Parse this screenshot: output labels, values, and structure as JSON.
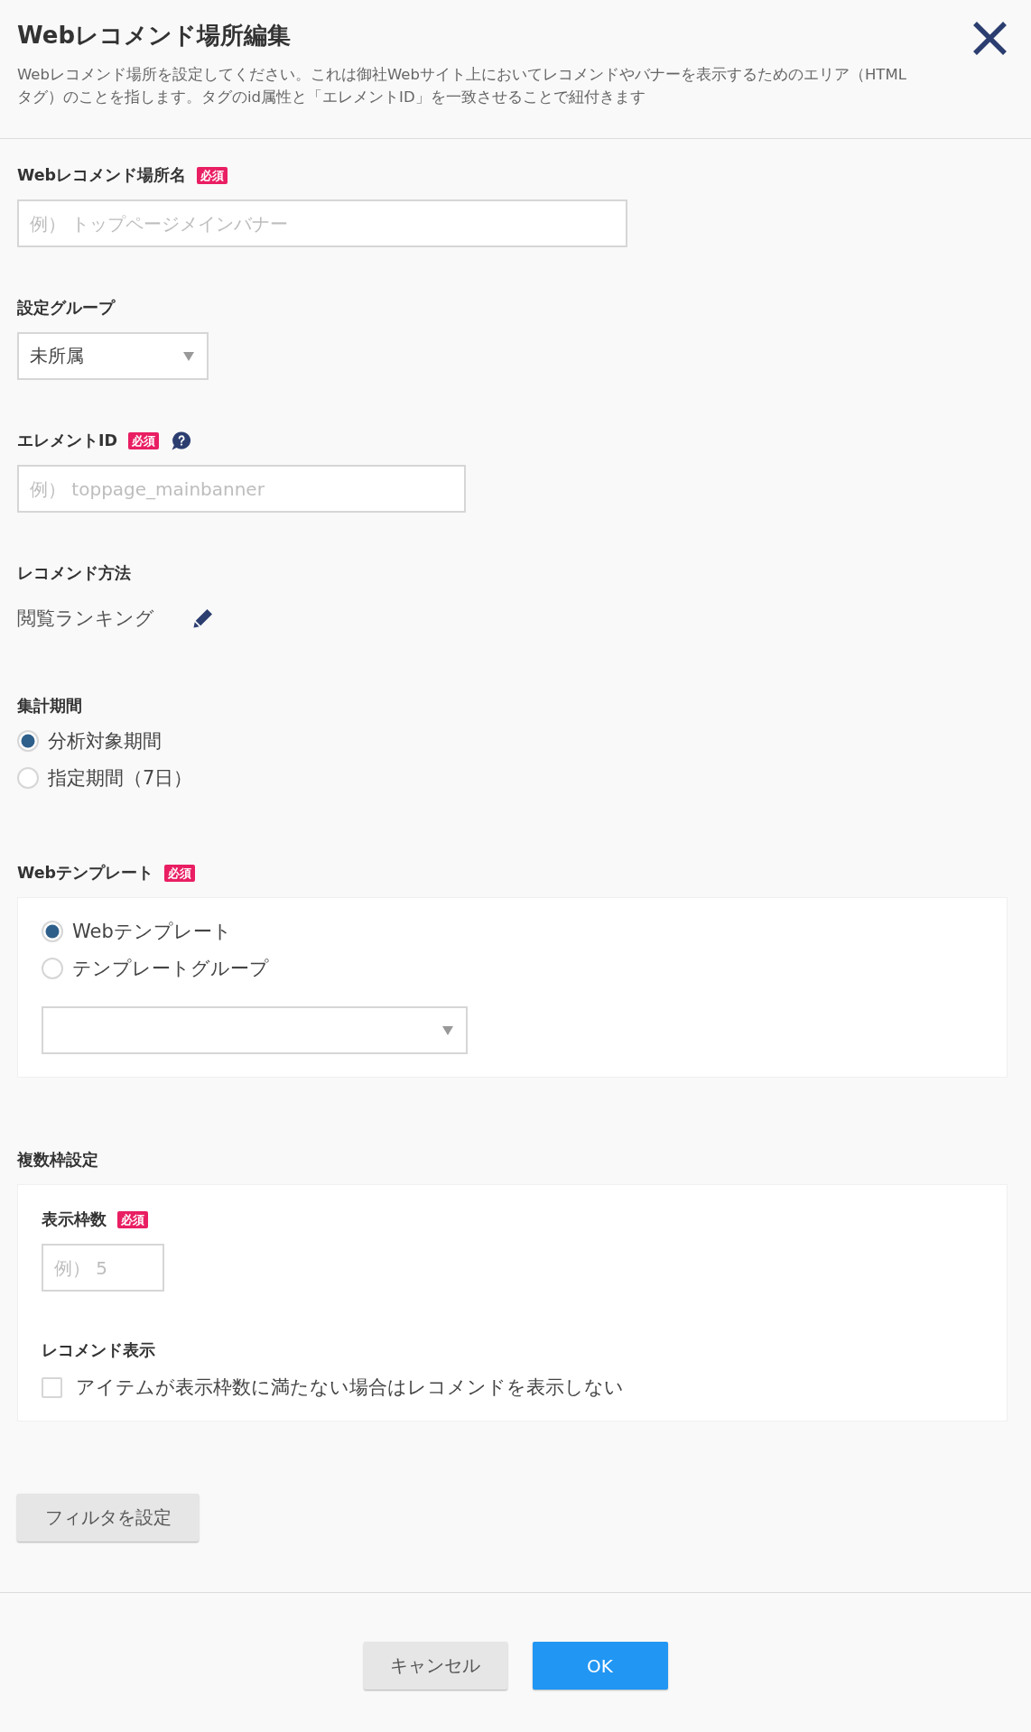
{
  "header": {
    "title": "Webレコメンド場所編集",
    "description": "Webレコメンド場所を設定してください。これは御社Webサイト上においてレコメンドやバナーを表示するためのエリア（HTMLタグ）のことを指します。タグのid属性と「エレメントID」を一致させることで紐付きます"
  },
  "sections": [
    {
      "kind": "input",
      "label": "Webレコメンド場所名",
      "badge": "必須",
      "placeholder": "例） トップページメインバナー"
    },
    {
      "kind": "select",
      "label": "設定グループ",
      "value": "未所属"
    },
    {
      "kind": "input",
      "label": "エレメントID",
      "badge": "必須",
      "help": true,
      "placeholder": "例） toppage_mainbanner"
    },
    {
      "kind": "method",
      "label": "レコメンド方法",
      "value": "閲覧ランキング"
    },
    {
      "kind": "radios",
      "label": "集計期間",
      "options": [
        {
          "label": "分析対象期間",
          "selected": true
        },
        {
          "label": "指定期間（7日）",
          "selected": false
        }
      ]
    },
    {
      "kind": "card",
      "label": "Webテンプレート",
      "badge": "必須",
      "items": [
        {
          "kind": "radios",
          "options": [
            {
              "label": "Webテンプレート",
              "selected": true
            },
            {
              "label": "テンプレートグループ",
              "selected": false
            }
          ]
        },
        {
          "kind": "select"
        }
      ]
    },
    {
      "kind": "card",
      "label": "複数枠設定",
      "items": [
        {
          "kind": "input",
          "label": "表示枠数",
          "badge": "必須",
          "placeholder": "例） 5"
        },
        {
          "kind": "checkbox",
          "label": "レコメンド表示",
          "text": "アイテムが表示枠数に満たない場合はレコメンドを表示しない",
          "checked": false
        }
      ]
    },
    {
      "kind": "button",
      "label": "フィルタを設定"
    }
  ],
  "footer": {
    "buttons": [
      {
        "kind": "secondary",
        "label": "キャンセル"
      },
      {
        "kind": "primary",
        "label": "OK"
      }
    ]
  }
}
